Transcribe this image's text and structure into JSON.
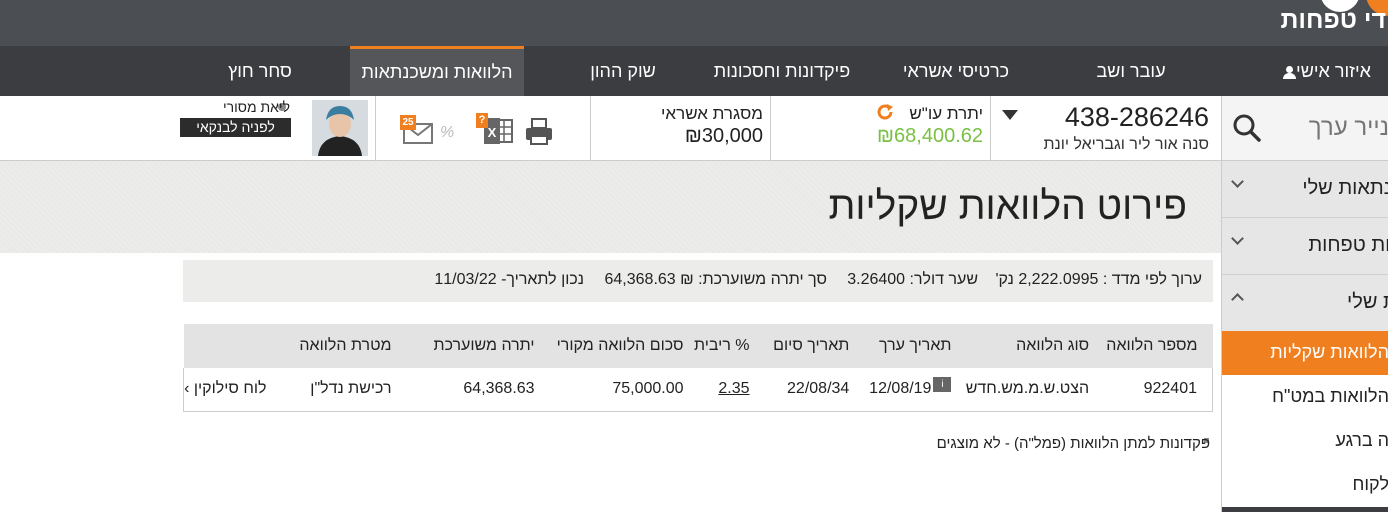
{
  "top": {
    "logo_text": "די טפחות"
  },
  "nav": {
    "personal_area": "איזור אישי",
    "items": [
      "עובר ושב",
      "כרטיסי אשראי",
      "פיקדונות וחסכונות",
      "שוק ההון",
      "הלוואות ומשכנתאות",
      "סחר חוץ"
    ],
    "active": "הלוואות ומשכנתאות"
  },
  "account": {
    "search_placeholder": "נייר ערך",
    "number": "438-286246",
    "owner": "סנה אור ליר וגבריאל יונת",
    "balance_label": "יתרת עו\"ש",
    "balance_value": "₪68,400.62",
    "credit_label": "מסגרת אשראי",
    "credit_value": "₪30,000",
    "mail_badge": "25",
    "excel_badge": "?",
    "pct_label": "%",
    "banker_name": "ליאת מסורי",
    "contact_button": "לפניה לבנקאי"
  },
  "sidebar": {
    "items": [
      "כנתאות שלי",
      "עות טפחות",
      "ות שלי"
    ],
    "sub_items": [
      "הלוואות שקליות",
      "הלוואות במט\"ח",
      "ה ברגע",
      "לקוח"
    ],
    "active_sub": "הלוואות שקליות"
  },
  "page": {
    "title": "פירוט הלוואות שקליות",
    "summary": {
      "index_value": "ערוך לפי מדד : 2,222.0995 נק'",
      "dollar_rate": "שער דולר: 3.26400",
      "total_balance": "סך יתרה משוערכת:  ₪ 64,368.63",
      "as_of": "נכון לתאריך- 11/03/22"
    },
    "table": {
      "headers": [
        "מספר הלוואה",
        "סוג הלוואה",
        "תאריך ערך",
        "תאריך סיום",
        "% ריבית",
        "סכום הלוואה מקורי",
        "יתרה משוערכת",
        "מטרת הלוואה",
        ""
      ],
      "info_badge": "i",
      "rows": [
        {
          "loan_number": "922401",
          "loan_type": "הצט.ש.מ.מש.חדש",
          "value_date": "12/08/19",
          "end_date": "22/08/34",
          "interest": "2.35",
          "original_amount": "75,000.00",
          "revalued_balance": "64,368.63",
          "purpose": "רכישת נדל\"ן",
          "schedule_link": "לוח סילוקין ›"
        }
      ]
    },
    "footnote": "פקדונות למתן הלוואות (פמל\"ה) - לא מוצגים"
  }
}
